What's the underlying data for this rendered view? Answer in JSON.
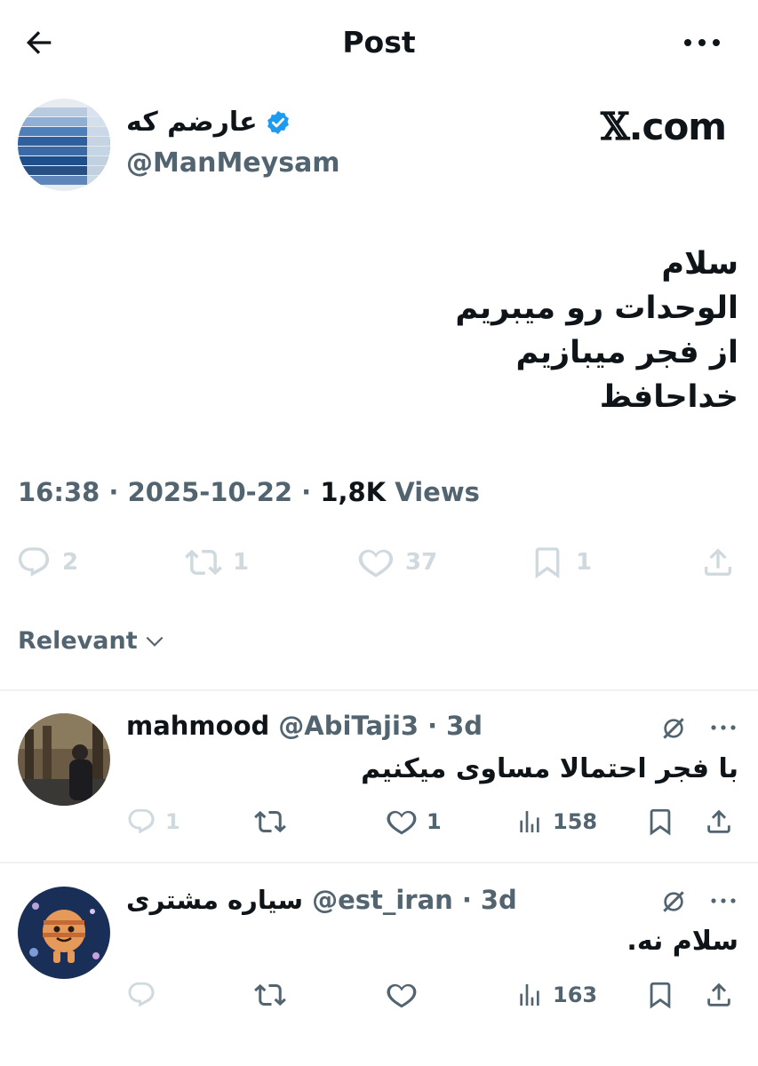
{
  "header": {
    "title": "Post"
  },
  "author": {
    "name": "عارضم که",
    "handle": "@ManMeysam",
    "verified": true
  },
  "watermark": {
    "x": "𝕏",
    "domain": ".com"
  },
  "post": {
    "lines": [
      "سلام",
      "الوحدات رو میبریم",
      "از فجر میبازیم",
      "خداحافظ"
    ],
    "time": "16:38",
    "date": "2025-10-22",
    "views_count": "1,8K",
    "views_label": "Views",
    "sep": "·",
    "stats": {
      "replies": "2",
      "reposts": "1",
      "likes": "37",
      "bookmarks": "1"
    }
  },
  "sort": {
    "label": "Relevant"
  },
  "replies": [
    {
      "name": "mahmood",
      "handle": "@AbiTaji3",
      "age": "3d",
      "text": "با فجر احتمالا مساوی میکنیم",
      "replies": "1",
      "reposts": "",
      "likes": "1",
      "views": "158"
    },
    {
      "name": "سیاره مشتری",
      "handle": "@est_iran",
      "age": "3d",
      "text": "سلام نه.",
      "replies": "",
      "reposts": "",
      "likes": "",
      "views": "163"
    }
  ],
  "colors": {
    "text": "#0f1419",
    "secondary": "#536471",
    "faded": "#cfd9de",
    "verified": "#1d9bf0",
    "divider": "#eff3f4"
  },
  "icons": [
    "back-arrow-icon",
    "more-icon",
    "verified-badge-icon",
    "reply-icon",
    "repost-icon",
    "like-icon",
    "bookmark-icon",
    "share-icon",
    "views-icon",
    "grok-icon",
    "chevron-down-icon"
  ]
}
